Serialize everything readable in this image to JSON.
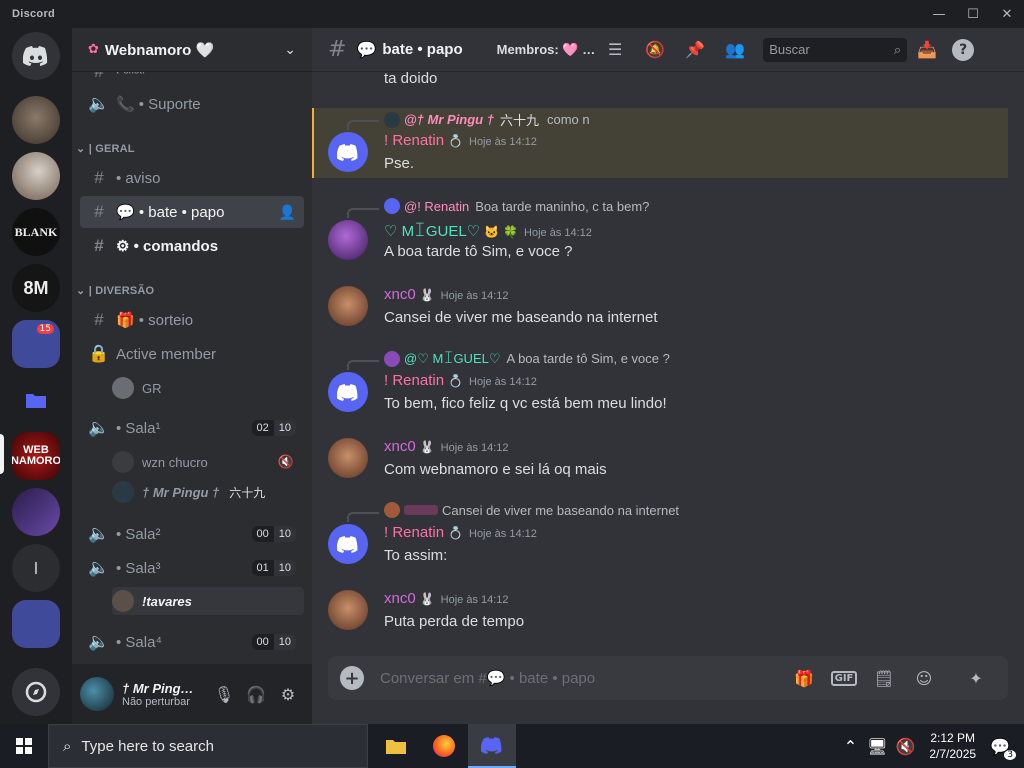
{
  "window": {
    "app_name": "Discord"
  },
  "server": {
    "name": "Webnamoro 🤍"
  },
  "sidebar": {
    "partial_top": "ᵗ ˢⁿˢᵗʳ",
    "suporte": "Suporte",
    "cat_geral": "| GERAL",
    "aviso": "aviso",
    "bate_papo": "💬 • bate • papo",
    "comandos": "⚙ • comandos",
    "cat_diversao": "| DIVERSÃO",
    "sorteio": "sorteio",
    "active_member": "Active member",
    "gr_user": "GR",
    "sala1": "Sala¹",
    "sala1_counts": [
      "02",
      "10"
    ],
    "sala1_users": [
      "wzn chucro",
      "† Mr Pingu †"
    ],
    "sala1_user2_suffix": "六十九",
    "sala2": "Sala²",
    "sala2_counts": [
      "00",
      "10"
    ],
    "sala3": "Sala³",
    "sala3_counts": [
      "01",
      "10"
    ],
    "sala3_user": "!tavares",
    "sala4": "Sala⁴",
    "sala4_counts": [
      "00",
      "10"
    ]
  },
  "user_panel": {
    "name": "† Mr Ping…",
    "status": "Não perturbar"
  },
  "topbar": {
    "channel": "bate • papo",
    "members_label": "Membros:",
    "members_suffix": "…",
    "search_placeholder": "Buscar"
  },
  "messages": {
    "partial_text": "ta doido",
    "m1": {
      "reply_author": "@† Mr Pingu †",
      "reply_suffix": "六十九",
      "reply_text": "como n",
      "author": "! Renatin",
      "time": "Hoje às 14:12",
      "text": "Pse."
    },
    "m2": {
      "reply_author": "@! Renatin",
      "reply_text": "Boa tarde maninho, c ta bem?",
      "author": "♡ ΜꀤGUEL♡",
      "time": "Hoje às 14:12",
      "text": "A boa tarde tô Sim, e voce ?"
    },
    "m3": {
      "author": "xnc0",
      "time": "Hoje às 14:12",
      "text": "Cansei de viver me baseando na internet"
    },
    "m4": {
      "reply_author": "@♡ ΜꀤGUEL♡",
      "reply_text": "A boa tarde tô Sim, e voce ?",
      "author": "! Renatin",
      "time": "Hoje às 14:12",
      "text": "To bem, fico feliz q vc está bem meu lindo!"
    },
    "m5": {
      "author": "xnc0",
      "time": "Hoje às 14:12",
      "text": "Com webnamoro e sei lá oq mais"
    },
    "m6": {
      "reply_text": "Cansei de viver me baseando na internet",
      "author": "! Renatin",
      "time": "Hoje às 14:12",
      "text": "To assim:"
    },
    "m7": {
      "author": "xnc0",
      "time": "Hoje às 14:12",
      "text": "Puta perda de tempo"
    }
  },
  "composer": {
    "placeholder": "Conversar em #💬 • bate • papo",
    "gif_label": "GIF"
  },
  "taskbar": {
    "search_placeholder": "Type here to search",
    "time": "2:12 PM",
    "date": "2/7/2025",
    "notif_count": "3"
  },
  "colors": {
    "renatin": "#ff6fa8",
    "miguel": "#4fe3c1",
    "xnc0": "#d46ad6",
    "blurple": "#5865f2"
  }
}
